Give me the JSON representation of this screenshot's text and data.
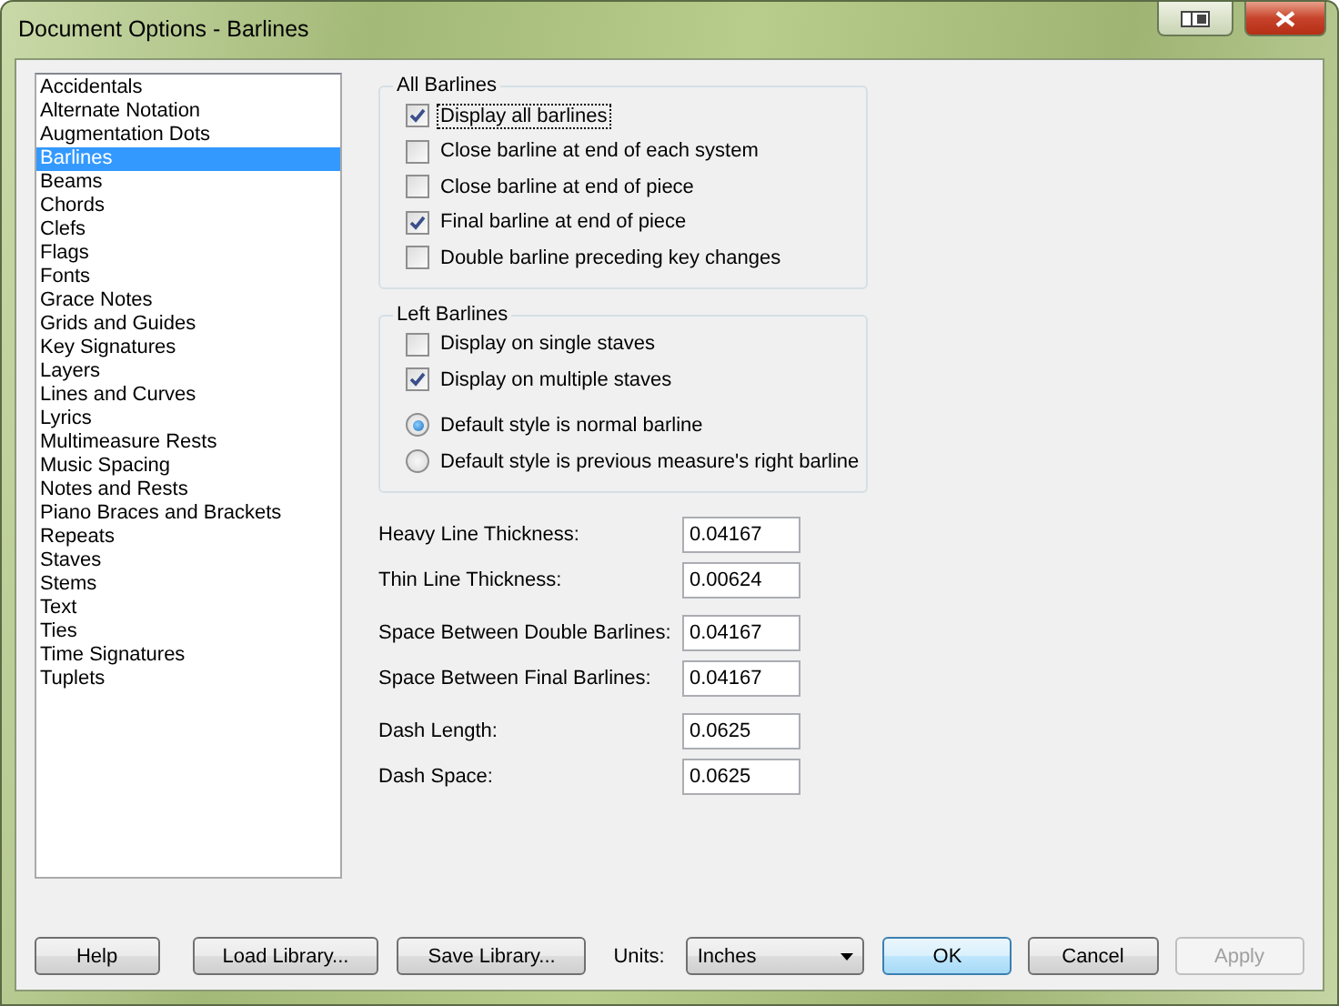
{
  "window": {
    "title": "Document Options - Barlines"
  },
  "sidebar": {
    "items": [
      {
        "label": "Accidentals",
        "selected": false
      },
      {
        "label": "Alternate Notation",
        "selected": false
      },
      {
        "label": "Augmentation Dots",
        "selected": false
      },
      {
        "label": "Barlines",
        "selected": true
      },
      {
        "label": "Beams",
        "selected": false
      },
      {
        "label": "Chords",
        "selected": false
      },
      {
        "label": "Clefs",
        "selected": false
      },
      {
        "label": "Flags",
        "selected": false
      },
      {
        "label": "Fonts",
        "selected": false
      },
      {
        "label": "Grace Notes",
        "selected": false
      },
      {
        "label": "Grids and Guides",
        "selected": false
      },
      {
        "label": "Key Signatures",
        "selected": false
      },
      {
        "label": "Layers",
        "selected": false
      },
      {
        "label": "Lines and Curves",
        "selected": false
      },
      {
        "label": "Lyrics",
        "selected": false
      },
      {
        "label": "Multimeasure Rests",
        "selected": false
      },
      {
        "label": "Music Spacing",
        "selected": false
      },
      {
        "label": "Notes and Rests",
        "selected": false
      },
      {
        "label": "Piano Braces and Brackets",
        "selected": false
      },
      {
        "label": "Repeats",
        "selected": false
      },
      {
        "label": "Staves",
        "selected": false
      },
      {
        "label": "Stems",
        "selected": false
      },
      {
        "label": "Text",
        "selected": false
      },
      {
        "label": "Ties",
        "selected": false
      },
      {
        "label": "Time Signatures",
        "selected": false
      },
      {
        "label": "Tuplets",
        "selected": false
      }
    ]
  },
  "groups": [
    {
      "title": "All Barlines",
      "items": [
        {
          "kind": "checkbox",
          "label": "Display all barlines",
          "checked": true,
          "focused": true
        },
        {
          "kind": "checkbox",
          "label": "Close barline at end of each system",
          "checked": false,
          "focused": false
        },
        {
          "kind": "checkbox",
          "label": "Close barline at end of piece",
          "checked": false,
          "focused": false
        },
        {
          "kind": "checkbox",
          "label": "Final barline at end of piece",
          "checked": true,
          "focused": false
        },
        {
          "kind": "checkbox",
          "label": "Double barline preceding key changes",
          "checked": false,
          "focused": false
        }
      ]
    },
    {
      "title": "Left Barlines",
      "items": [
        {
          "kind": "checkbox",
          "label": "Display on single staves",
          "checked": false,
          "focused": false
        },
        {
          "kind": "checkbox",
          "label": "Display on multiple staves",
          "checked": true,
          "focused": false
        },
        {
          "kind": "radio",
          "label": "Default style is normal barline",
          "selected": true,
          "focused": false
        },
        {
          "kind": "radio",
          "label": "Default style is previous measure's right barline",
          "selected": false,
          "focused": false
        }
      ]
    }
  ],
  "field_groups": [
    {
      "fields": [
        {
          "label": "Heavy Line Thickness:",
          "value": "0.04167"
        },
        {
          "label": "Thin Line Thickness:",
          "value": "0.00624"
        }
      ]
    },
    {
      "fields": [
        {
          "label": "Space Between Double Barlines:",
          "value": "0.04167"
        },
        {
          "label": "Space Between Final Barlines:",
          "value": "0.04167"
        }
      ]
    },
    {
      "fields": [
        {
          "label": "Dash Length:",
          "value": "0.0625"
        },
        {
          "label": "Dash Space:",
          "value": "0.0625"
        }
      ]
    }
  ],
  "footer": {
    "left_buttons": [
      {
        "label": "Help"
      },
      {
        "label": "Load Library..."
      },
      {
        "label": "Save Library..."
      }
    ],
    "units": {
      "label": "Units:",
      "value": "Inches"
    },
    "right_buttons": [
      {
        "label": "OK",
        "default": true,
        "disabled": false
      },
      {
        "label": "Cancel",
        "default": false,
        "disabled": false
      },
      {
        "label": "Apply",
        "default": false,
        "disabled": true
      }
    ]
  }
}
